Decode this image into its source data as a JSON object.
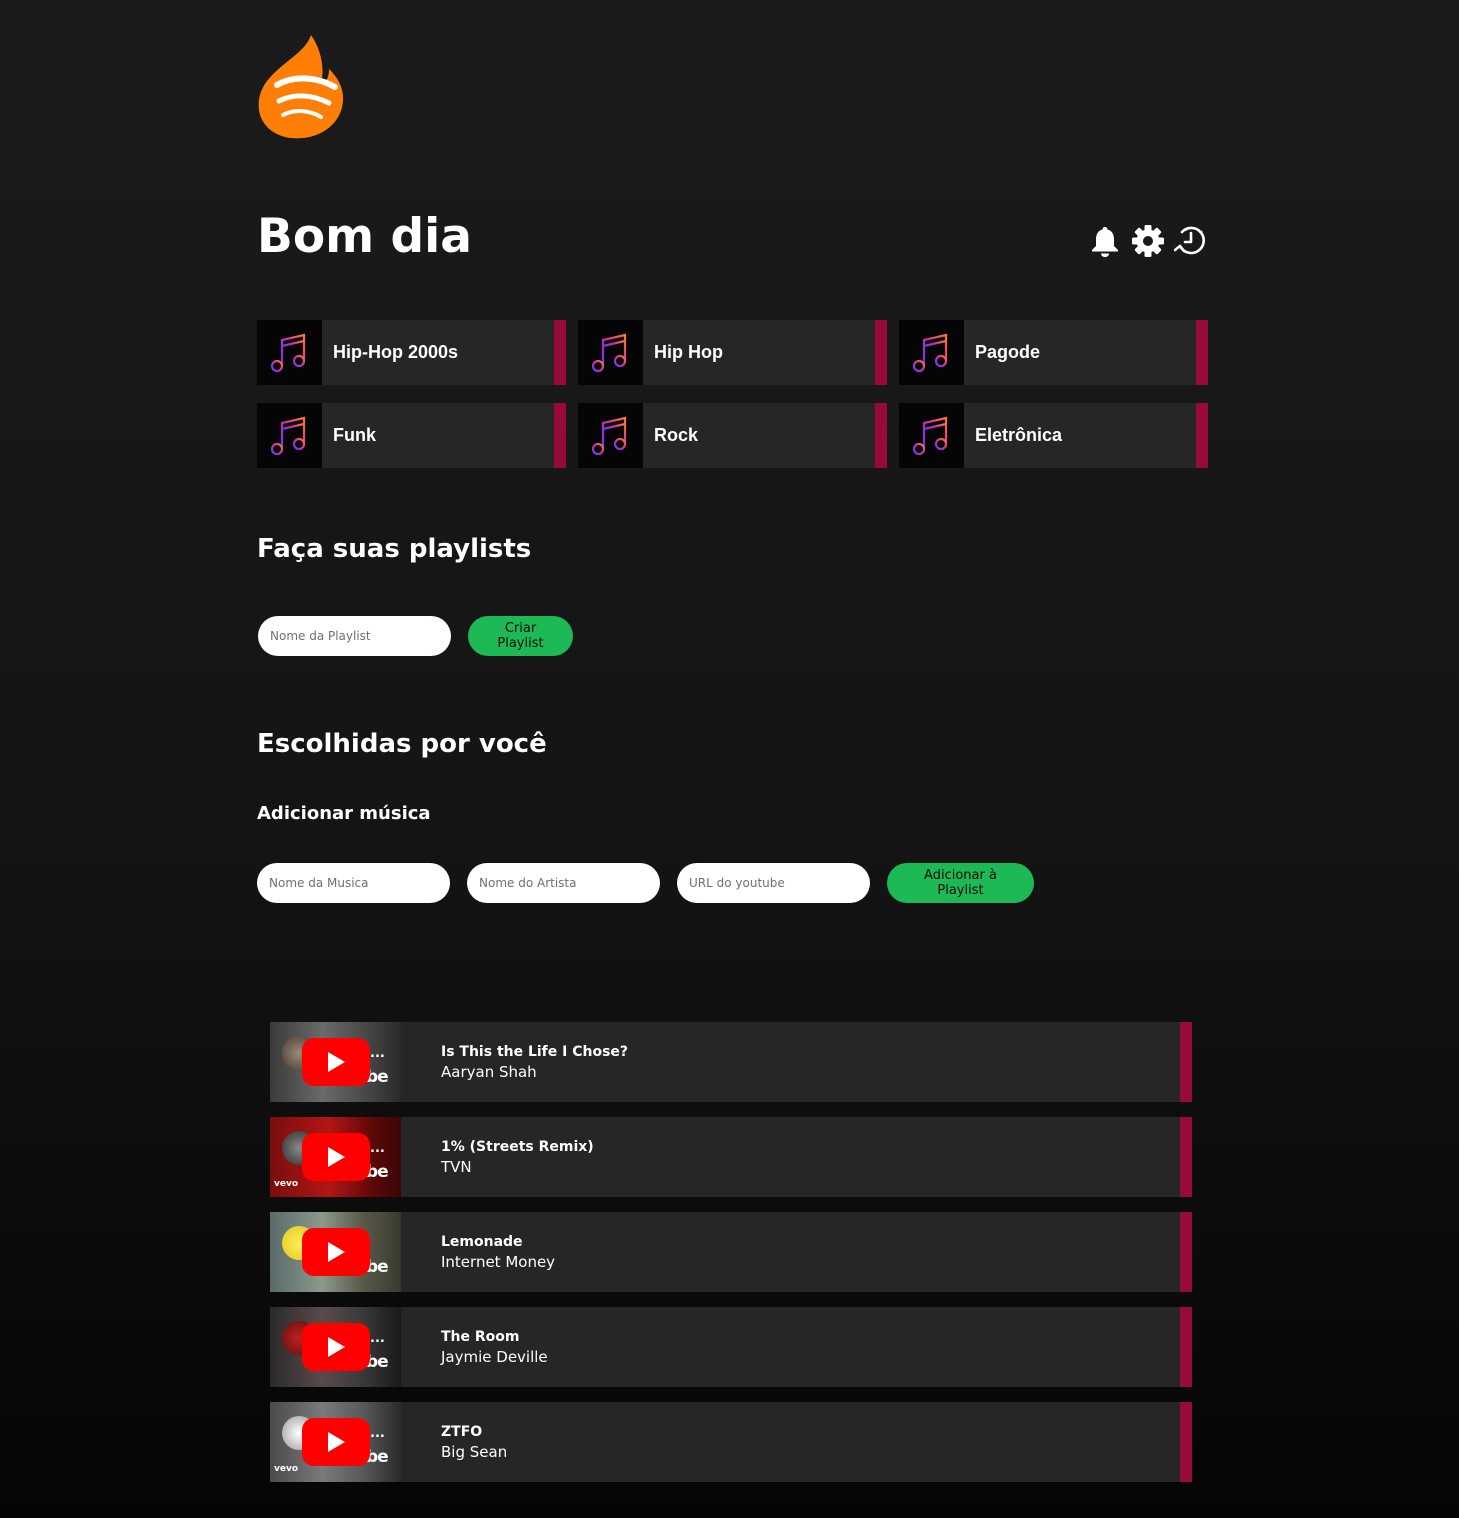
{
  "header": {
    "greeting": "Bom dia",
    "icons": [
      "bell-icon",
      "gear-icon",
      "history-icon"
    ]
  },
  "colors": {
    "accent_orange": "#ff7f06",
    "accent_green": "#1db954",
    "card_bar": "#970a3d",
    "card_bg": "#262627",
    "youtube_red": "#ff0000"
  },
  "genres": [
    {
      "label": "Hip-Hop 2000s",
      "icon": "music-note-icon"
    },
    {
      "label": "Hip Hop",
      "icon": "music-note-icon"
    },
    {
      "label": "Pagode",
      "icon": "music-note-icon"
    },
    {
      "label": "Funk",
      "icon": "music-note-icon"
    },
    {
      "label": "Rock",
      "icon": "music-note-icon"
    },
    {
      "label": "Eletrônica",
      "icon": "music-note-icon"
    }
  ],
  "create_playlist": {
    "title": "Faça suas playlists",
    "name_placeholder": "Nome da Playlist",
    "button_label": "Criar Playlist"
  },
  "recommended": {
    "title": "Escolhidas por você",
    "add_music_title": "Adicionar música",
    "song_placeholder": "Nome da Musica",
    "artist_placeholder": "Nome do Artista",
    "url_placeholder": "URL do youtube",
    "add_button_label": "Adicionar à Playlist"
  },
  "tracks": [
    {
      "title": "Is This the Life I Chose?",
      "artist": "Aaryan Shah",
      "thumb_overlay": "...",
      "thumb_brand": "be",
      "thumb_badge": ""
    },
    {
      "title": "1% (Streets Remix)",
      "artist": "TVN",
      "thumb_overlay": "...",
      "thumb_brand": "be",
      "thumb_badge": "vevo"
    },
    {
      "title": "Lemonade",
      "artist": "Internet Money",
      "thumb_overlay": "",
      "thumb_brand": "be",
      "thumb_badge": ""
    },
    {
      "title": "The Room",
      "artist": "Jaymie Deville",
      "thumb_overlay": "...",
      "thumb_brand": "be",
      "thumb_badge": ""
    },
    {
      "title": "ZTFO",
      "artist": "Big Sean",
      "thumb_overlay": "...",
      "thumb_brand": "be",
      "thumb_badge": "vevo"
    }
  ]
}
